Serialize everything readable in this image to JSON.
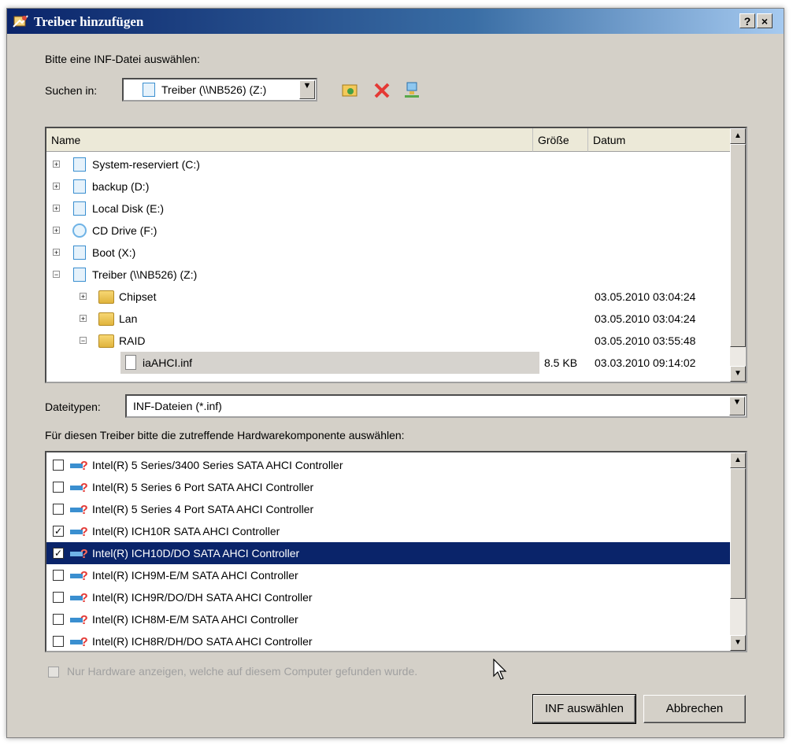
{
  "window": {
    "title": "Treiber hinzufügen",
    "help_label": "?",
    "close_label": "×"
  },
  "prompt_select_inf": "Bitte eine INF-Datei auswählen:",
  "look_in": {
    "label": "Suchen in:",
    "value": "Treiber (\\\\NB526) (Z:)"
  },
  "toolbar_icons": [
    "add-drive-icon",
    "delete-icon",
    "network-icon"
  ],
  "file_columns": {
    "name": "Name",
    "size": "Größe",
    "date": "Datum"
  },
  "tree_items": [
    {
      "name": "System-reserviert (C:)",
      "size": "",
      "date": "",
      "icon": "drive-icon"
    },
    {
      "name": "backup (D:)",
      "size": "",
      "date": "",
      "icon": "drive-icon"
    },
    {
      "name": "Local Disk (E:)",
      "size": "",
      "date": "",
      "icon": "drive-icon"
    },
    {
      "name": "CD Drive (F:)",
      "size": "",
      "date": "",
      "icon": "cd-icon"
    },
    {
      "name": "Boot (X:)",
      "size": "",
      "date": "",
      "icon": "drive-icon"
    },
    {
      "name": "Treiber (\\\\NB526) (Z:)",
      "size": "",
      "date": "",
      "icon": "drive-icon"
    },
    {
      "name": "Chipset",
      "size": "",
      "date": "03.05.2010 03:04:24",
      "icon": "folder-icon"
    },
    {
      "name": "Lan",
      "size": "",
      "date": "03.05.2010 03:04:24",
      "icon": "folder-icon"
    },
    {
      "name": "RAID",
      "size": "",
      "date": "03.05.2010 03:55:48",
      "icon": "folder-icon"
    },
    {
      "name": "iaAHCI.inf",
      "size": "8.5 KB",
      "date": "03.03.2010 09:14:02",
      "icon": "inf-file-icon"
    }
  ],
  "file_types": {
    "label": "Dateitypen:",
    "value": "INF-Dateien (*.inf)"
  },
  "hardware_prompt": "Für diesen Treiber bitte die zutreffende Hardwarekomponente auswählen:",
  "hardware_items": [
    {
      "label": "Intel(R) 5 Series/3400 Series SATA AHCI Controller",
      "checked": false
    },
    {
      "label": "Intel(R) 5 Series 6 Port SATA AHCI Controller",
      "checked": false
    },
    {
      "label": "Intel(R) 5 Series 4 Port SATA AHCI Controller",
      "checked": false
    },
    {
      "label": "Intel(R) ICH10R SATA AHCI Controller",
      "checked": true
    },
    {
      "label": "Intel(R) ICH10D/DO SATA AHCI Controller",
      "checked": true,
      "selected": true
    },
    {
      "label": "Intel(R) ICH9M-E/M SATA AHCI Controller",
      "checked": false
    },
    {
      "label": "Intel(R) ICH9R/DO/DH SATA AHCI Controller",
      "checked": false
    },
    {
      "label": "Intel(R) ICH8M-E/M SATA AHCI Controller",
      "checked": false
    },
    {
      "label": "Intel(R) ICH8R/DH/DO SATA AHCI Controller",
      "checked": false
    }
  ],
  "show_found_only": {
    "label": "Nur Hardware anzeigen, welche auf diesem Computer gefunden wurde.",
    "checked": false,
    "enabled": false
  },
  "buttons": {
    "select_inf": "INF auswählen",
    "cancel": "Abbrechen"
  },
  "colors": {
    "title_start": "#0a246a",
    "selection": "#0a246a",
    "dialog_bg": "#d4d0c8"
  }
}
